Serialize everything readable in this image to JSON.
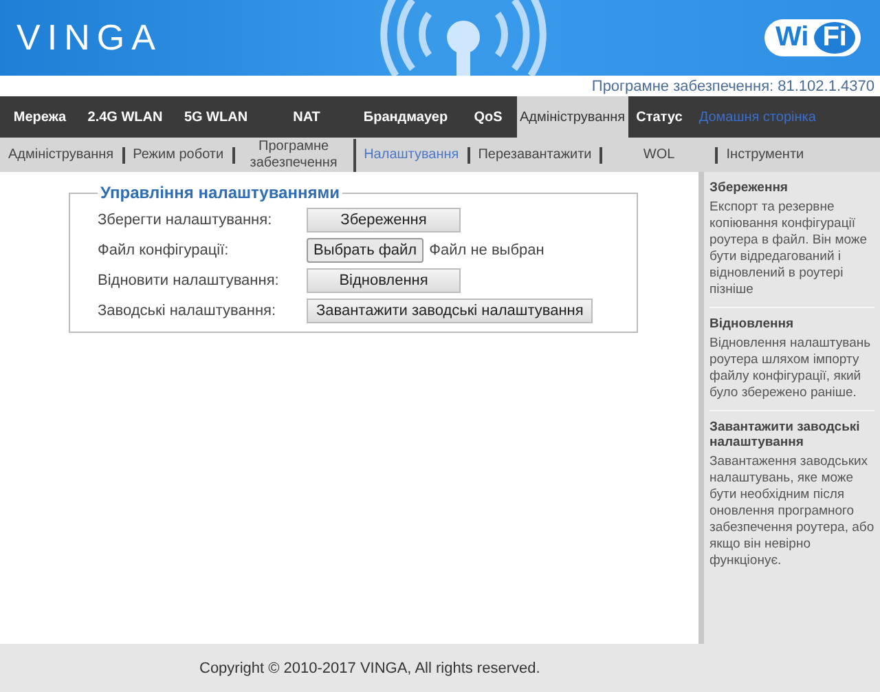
{
  "header": {
    "logo": "VINGA",
    "wifi_badge": [
      "Wi",
      "Fi"
    ]
  },
  "firmware_version": "Програмне забезпечення: 81.102.1.4370",
  "nav": [
    {
      "label": "Мережа",
      "selected": false,
      "kind": "tab"
    },
    {
      "label": "2.4G WLAN",
      "selected": false,
      "kind": "tab"
    },
    {
      "label": "5G WLAN",
      "selected": false,
      "kind": "tab"
    },
    {
      "label": "NAT",
      "selected": false,
      "kind": "tab"
    },
    {
      "label": "Брандмауер",
      "selected": false,
      "kind": "tab"
    },
    {
      "label": "QoS",
      "selected": false,
      "kind": "tab"
    },
    {
      "label": "Адміністрування",
      "selected": true,
      "kind": "tab"
    },
    {
      "label": "Статус",
      "selected": false,
      "kind": "tab"
    },
    {
      "label": "Домашня сторінка",
      "selected": false,
      "kind": "link"
    }
  ],
  "subnav": [
    {
      "label": "Адміністрування",
      "selected": false
    },
    {
      "label": "Режим роботи",
      "selected": false
    },
    {
      "label": "Програмне забезпечення",
      "selected": false
    },
    {
      "label": "Налаштування",
      "selected": true
    },
    {
      "label": "Перезавантажити",
      "selected": false
    },
    {
      "label": "WOL",
      "selected": false
    },
    {
      "label": "Інструменти",
      "selected": false
    }
  ],
  "settings_group": {
    "title": "Управління налаштуваннями",
    "rows": [
      {
        "kind": "button",
        "label": "Зберегти налаштування:",
        "button": "Збереження"
      },
      {
        "kind": "file",
        "label": "Файл конфігурації:",
        "button": "Выбрать файл",
        "status": "Файл не выбран"
      },
      {
        "kind": "button",
        "label": "Відновити налаштування:",
        "button": "Відновлення"
      },
      {
        "kind": "button",
        "label": "Заводські налаштування:",
        "button": "Завантажити заводські налаштування"
      }
    ]
  },
  "help": [
    {
      "title": "Збереження",
      "text": "Експорт та резервне копіювання конфігурації роутера в файл. Він може бути відредагований і відновлений в роутері пізніше"
    },
    {
      "title": "Відновлення",
      "text": "Відновлення налаштувань роутера шляхом імпорту файлу конфігурації, який було збережено раніше."
    },
    {
      "title": "Завантажити заводські налаштування",
      "text": "Завантаження заводських налаштувань, яке може бути необхідним після оновлення програмного забезпечення роутера, або якщо він невірно функціонує."
    }
  ],
  "footer": "Copyright © 2010-2017 VINGA, All rights reserved."
}
